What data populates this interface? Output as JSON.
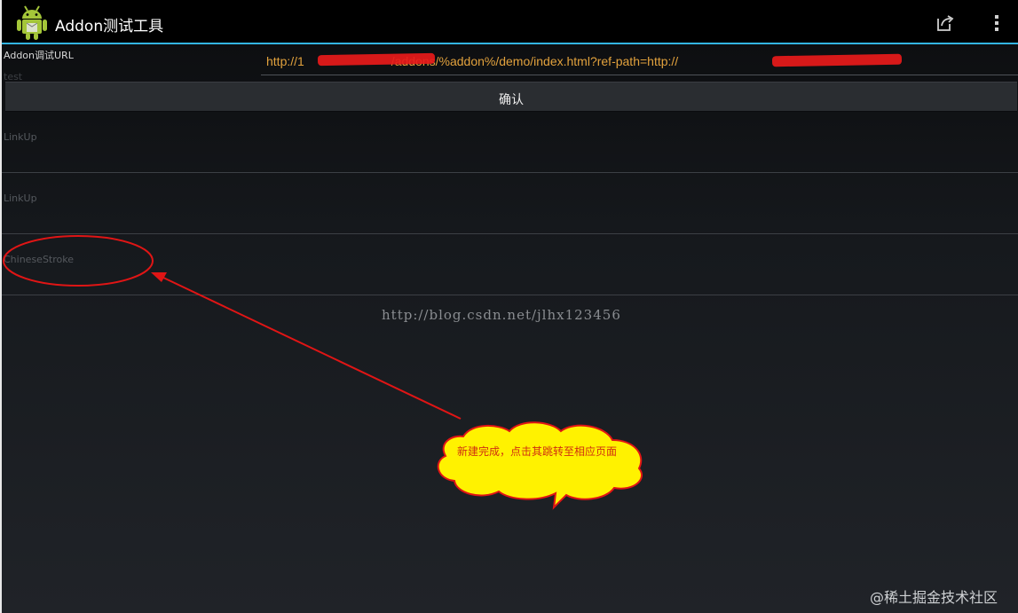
{
  "app": {
    "title": "Addon测试工具",
    "icon": "android-robot-icon"
  },
  "action_bar": {
    "share_icon": "share-icon",
    "overflow_icon": "overflow-menu-icon"
  },
  "form": {
    "url_label": "Addon调试URL",
    "url_value": "http://192.168.1.100:8080/addons/%addon%/demo/index.html?ref-path=http://192.168.1.100:8080",
    "url_value_visible": "http://1       /addons/%addon%/demo/index.html?ref-path=http://",
    "hidden_hint": "test",
    "confirm_label": "确认"
  },
  "list": {
    "items": [
      {
        "label": "LinkUp"
      },
      {
        "label": "LinkUp"
      },
      {
        "label": "ChineseStroke"
      }
    ]
  },
  "annotation": {
    "callout_text": "新建完成，点击其跳转至相应页面",
    "arrow_color": "#e01515",
    "callout_fill": "#fff200"
  },
  "watermarks": {
    "blog_url": "http://blog.csdn.net/jlhx123456",
    "site": "@稀土掘金技术社区"
  },
  "colors": {
    "accent": "#33b5e5",
    "url_text": "#e2a23d",
    "redaction": "#e81a1a"
  }
}
